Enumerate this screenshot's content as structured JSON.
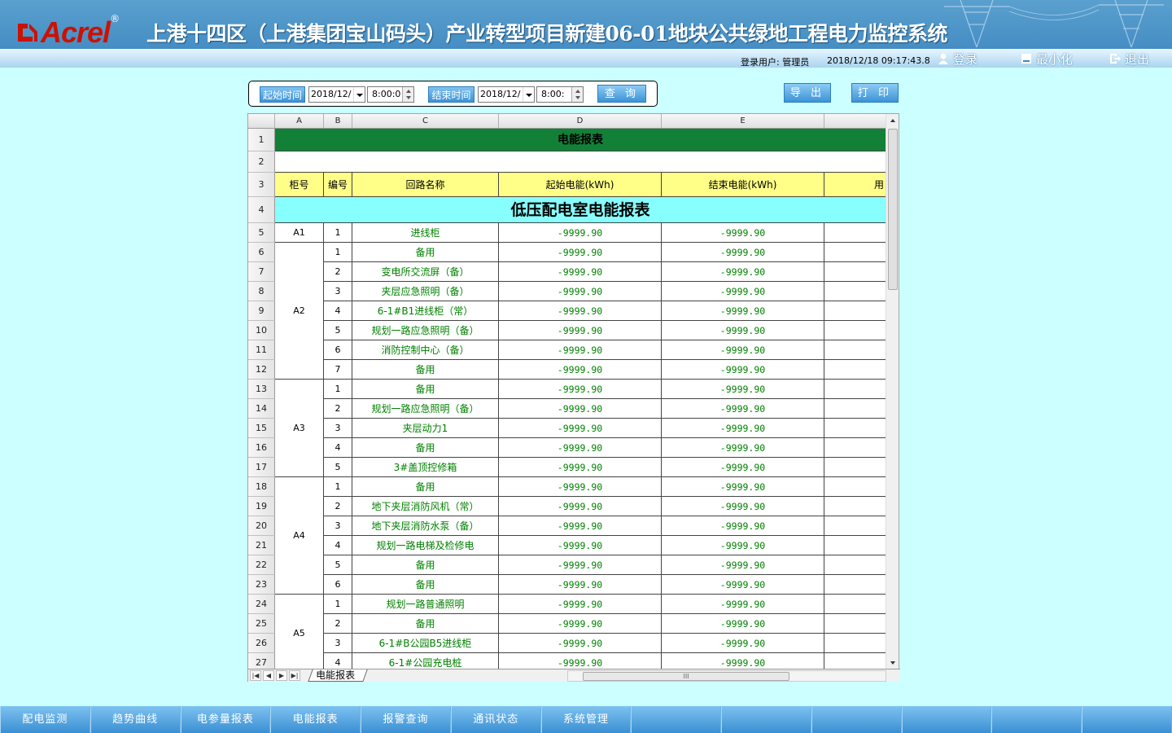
{
  "header": {
    "brand": "Acrel",
    "reg_mark": "®",
    "title": "上港十四区（上港集团宝山码头）产业转型项目新建06-01地块公共绿地工程电力监控系统",
    "user_label": "登录用户: 管理员",
    "datetime": "2018/12/18  09:17:43.8",
    "login": "登录",
    "minimize": "最小化",
    "exit": "退出"
  },
  "toolbar": {
    "start_label": "起始时间",
    "start_date": "2018/12/",
    "start_time": "8:00:0",
    "end_label": "结束时间",
    "end_date": "2018/12/",
    "end_time": "8:00:",
    "query": "查 询",
    "export": "导 出",
    "print": "打 印"
  },
  "sheet": {
    "columns": [
      "A",
      "B",
      "C",
      "D",
      "E"
    ],
    "title": "电能报表",
    "headers": [
      "柜号",
      "编号",
      "回路名称",
      "起始电能(kWh)",
      "结束电能(kWh)",
      "用"
    ],
    "section": "低压配电室电能报表",
    "value": "-9999.90",
    "groups": [
      {
        "cab": "A1",
        "row": 5,
        "span": 1
      },
      {
        "cab": "A2",
        "row": 6,
        "span": 7
      },
      {
        "cab": "A3",
        "row": 13,
        "span": 5
      },
      {
        "cab": "A4",
        "row": 18,
        "span": 6
      },
      {
        "cab": "A5",
        "row": 24,
        "span": 4
      }
    ],
    "rows": [
      {
        "n": "5",
        "no": "1",
        "name": "进线柜"
      },
      {
        "n": "6",
        "no": "1",
        "name": "备用"
      },
      {
        "n": "7",
        "no": "2",
        "name": "变电所交流屏（备）"
      },
      {
        "n": "8",
        "no": "3",
        "name": "夹层应急照明（备）"
      },
      {
        "n": "9",
        "no": "4",
        "name": "6-1#B1进线柜（常）"
      },
      {
        "n": "10",
        "no": "5",
        "name": "规划一路应急照明（备）"
      },
      {
        "n": "11",
        "no": "6",
        "name": "消防控制中心（备）"
      },
      {
        "n": "12",
        "no": "7",
        "name": "备用"
      },
      {
        "n": "13",
        "no": "1",
        "name": "备用"
      },
      {
        "n": "14",
        "no": "2",
        "name": "规划一路应急照明（备）"
      },
      {
        "n": "15",
        "no": "3",
        "name": "夹层动力1"
      },
      {
        "n": "16",
        "no": "4",
        "name": "备用"
      },
      {
        "n": "17",
        "no": "5",
        "name": "3#盖顶控修箱"
      },
      {
        "n": "18",
        "no": "1",
        "name": "备用"
      },
      {
        "n": "19",
        "no": "2",
        "name": "地下夹层消防风机（常）"
      },
      {
        "n": "20",
        "no": "3",
        "name": "地下夹层消防水泵（备）"
      },
      {
        "n": "21",
        "no": "4",
        "name": "规划一路电梯及检修电"
      },
      {
        "n": "22",
        "no": "5",
        "name": "备用"
      },
      {
        "n": "23",
        "no": "6",
        "name": "备用"
      },
      {
        "n": "24",
        "no": "1",
        "name": "规划一路普通照明"
      },
      {
        "n": "25",
        "no": "2",
        "name": "备用"
      },
      {
        "n": "26",
        "no": "3",
        "name": "6-1#B公园B5进线柜"
      },
      {
        "n": "27",
        "no": "4",
        "name": "6-1#公园充电桩"
      }
    ],
    "tab_name": "电能报表",
    "hscroll_grip": "III"
  },
  "nav": [
    "配电监测",
    "趋势曲线",
    "电参量报表",
    "电能报表",
    "报警查询",
    "通讯状态",
    "系统管理",
    "",
    "",
    "",
    "",
    "",
    ""
  ],
  "colors": {
    "title_row": "#138038",
    "header_row": "#ffff88",
    "section_row": "#88ffff",
    "accent": "#3c93d6"
  }
}
